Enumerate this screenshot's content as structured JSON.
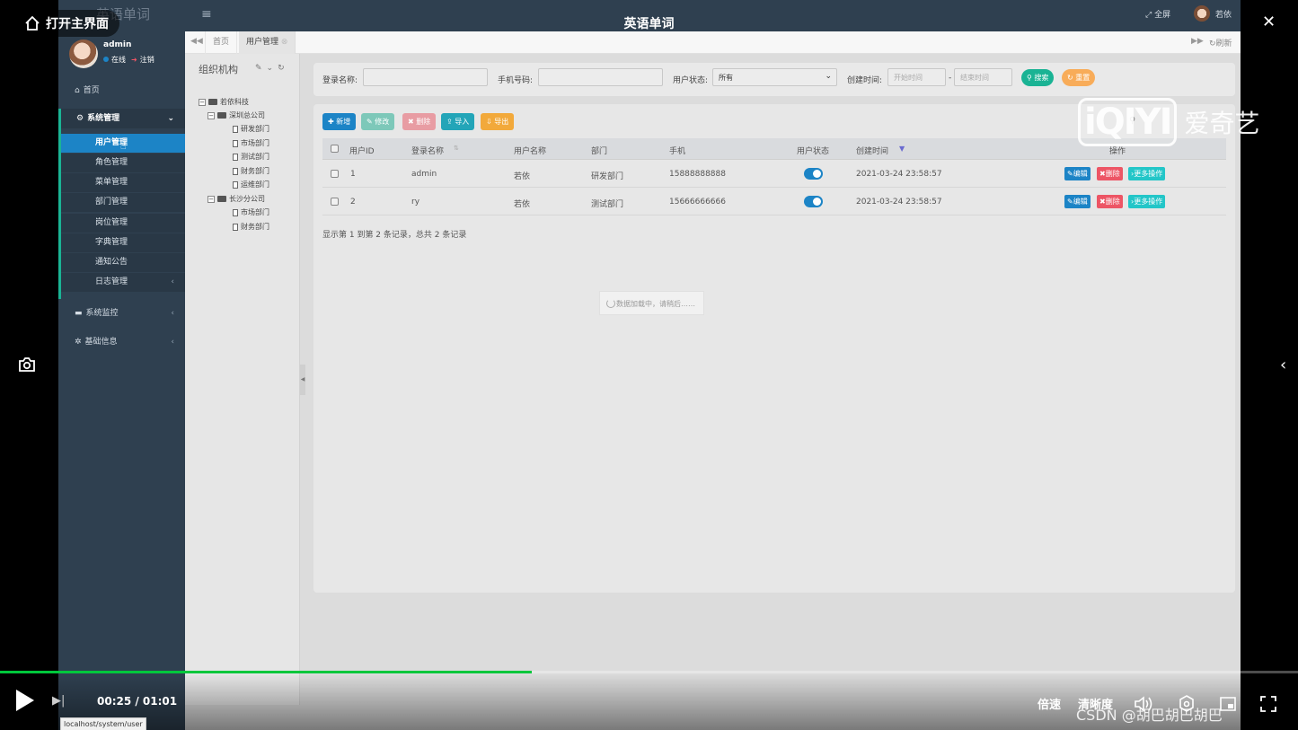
{
  "player": {
    "open_main_label": "打开主界面",
    "title": "英语单词",
    "time": "00:25 / 01:01",
    "progress": 0.41,
    "speed_label": "倍速",
    "quality_label": "清晰度",
    "accent": "#00c73c",
    "watermark_logo": "iQIYI",
    "watermark_cn": "爱奇艺",
    "credit": "CSDN @胡巴胡巴胡巴"
  },
  "app": {
    "brand": "英语单词",
    "user": {
      "name": "admin",
      "online": "在线",
      "logout": "注销"
    },
    "topbar": {
      "fullscreen": "全屏",
      "user": "若依"
    },
    "nav": {
      "home": "首页",
      "system": "系统管理",
      "system_items": [
        "用户管理",
        "角色管理",
        "菜单管理",
        "部门管理",
        "岗位管理",
        "字典管理",
        "通知公告",
        "日志管理"
      ],
      "monitor": "系统监控",
      "basic": "基础信息"
    },
    "tabs": {
      "home": "首页",
      "current": "用户管理",
      "refresh": "刷新"
    },
    "tree": {
      "title": "组织机构",
      "root": "若依科技",
      "branch1": "深圳总公司",
      "branch1_items": [
        "研发部门",
        "市场部门",
        "测试部门",
        "财务部门",
        "运维部门"
      ],
      "branch2": "长沙分公司",
      "branch2_items": [
        "市场部门",
        "财务部门"
      ]
    },
    "search": {
      "login_label": "登录名称:",
      "phone_label": "手机号码:",
      "status_label": "用户状态:",
      "status_value": "所有",
      "time_label": "创建时间:",
      "start_placeholder": "开始时间",
      "end_placeholder": "结束时间",
      "dash": "-",
      "search_btn": "搜索",
      "reset_btn": "重置"
    },
    "toolbar": {
      "add": "新增",
      "edit": "修改",
      "delete": "删除",
      "import": "导入",
      "export": "导出"
    },
    "table": {
      "headers": [
        "用户ID",
        "登录名称",
        "用户名称",
        "部门",
        "手机",
        "用户状态",
        "创建时间",
        "操作"
      ],
      "rows": [
        {
          "id": "1",
          "login": "admin",
          "name": "若依",
          "dept": "研发部门",
          "phone": "15888888888",
          "created": "2021-03-24 23:58:57"
        },
        {
          "id": "2",
          "login": "ry",
          "name": "若依",
          "dept": "测试部门",
          "phone": "15666666666",
          "created": "2021-03-24 23:58:57"
        }
      ],
      "op_edit": "编辑",
      "op_delete": "删除",
      "op_more": "更多操作",
      "summary": "显示第 1 到第 2 条记录，总共 2 条记录",
      "loading": "数据加载中，请稍后……"
    },
    "status_url": "localhost/system/user"
  }
}
